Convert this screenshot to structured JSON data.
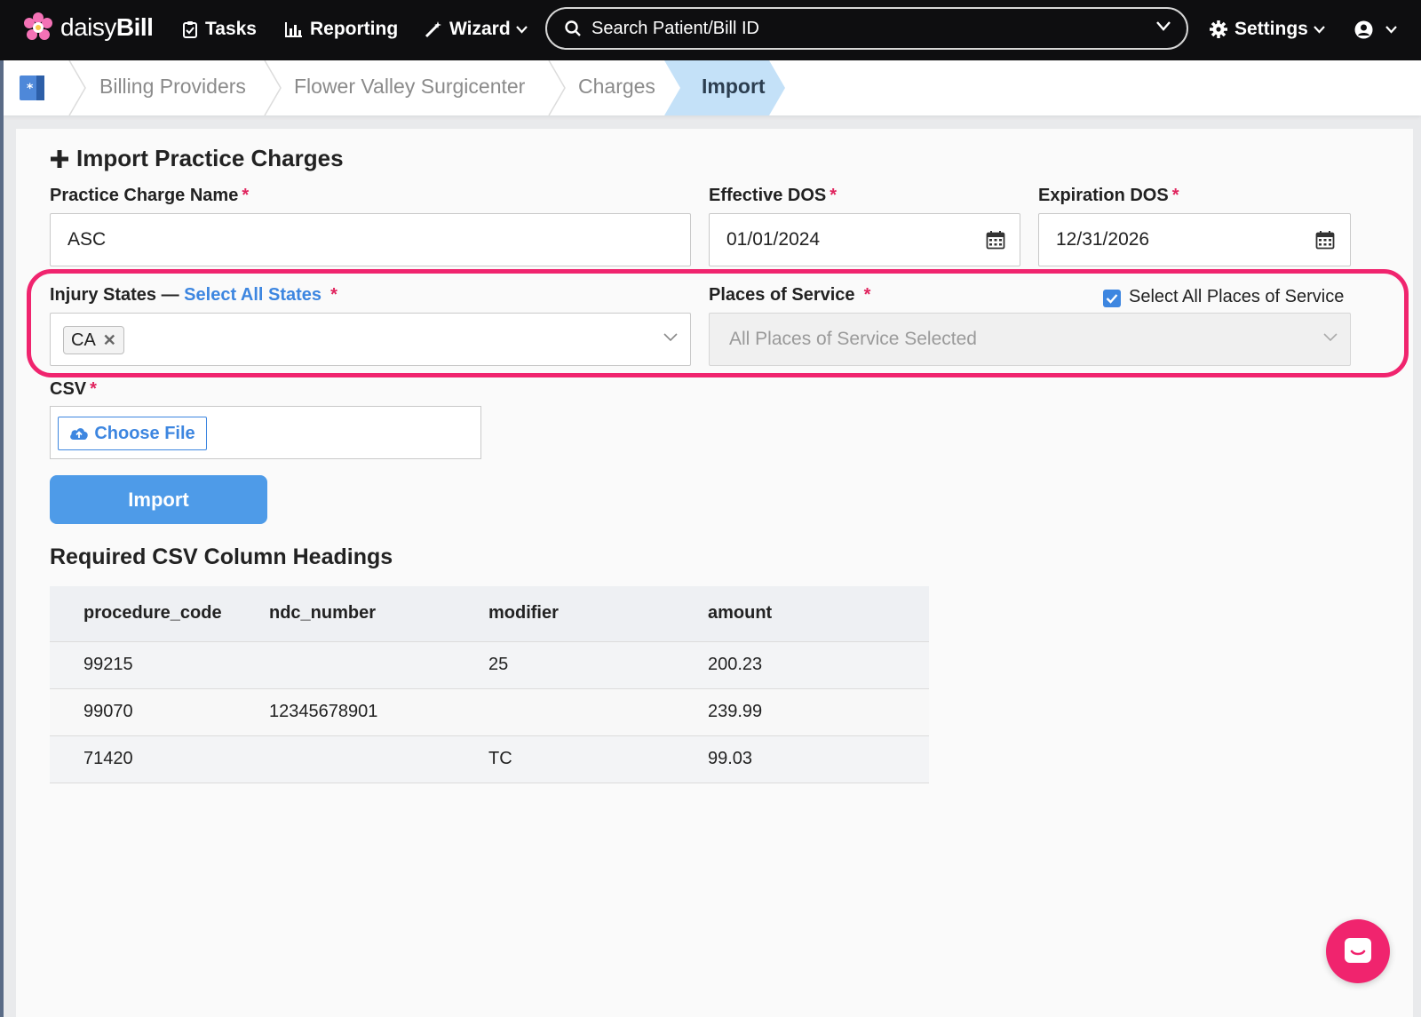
{
  "nav": {
    "brand_light": "daisy",
    "brand_bold": "Bill",
    "tasks": "Tasks",
    "reporting": "Reporting",
    "wizard": "Wizard",
    "search_placeholder": "Search Patient/Bill ID",
    "settings": "Settings"
  },
  "breadcrumb": {
    "items": [
      "Billing Providers",
      "Flower Valley Surgicenter",
      "Charges"
    ],
    "active": "Import"
  },
  "form": {
    "title": "Import Practice Charges",
    "charge_name_label": "Practice Charge Name",
    "charge_name_value": "ASC",
    "effective_label": "Effective DOS",
    "effective_value": "01/01/2024",
    "expiration_label": "Expiration DOS",
    "expiration_value": "12/31/2026",
    "injury_label": "Injury States —",
    "select_all_states": "Select All States",
    "selected_state": "CA",
    "pos_label": "Places of Service",
    "select_all_pos": "Select All Places of Service",
    "select_all_pos_checked": true,
    "pos_placeholder": "All Places of Service Selected",
    "csv_label": "CSV",
    "choose_file": "Choose File",
    "import_button": "Import",
    "required_mark": "*"
  },
  "csv_table": {
    "heading": "Required CSV Column Headings",
    "columns": [
      "procedure_code",
      "ndc_number",
      "modifier",
      "amount"
    ],
    "rows": [
      [
        "99215",
        "",
        "25",
        "200.23"
      ],
      [
        "99070",
        "12345678901",
        "",
        "239.99"
      ],
      [
        "71420",
        "",
        "TC",
        "99.03"
      ]
    ]
  },
  "colors": {
    "accent": "#3d86e0",
    "highlight": "#f0246e",
    "nav_bg": "#0e0e10",
    "breadcrumb_active": "#c4e1f8"
  },
  "icons": [
    "daisy-logo-icon",
    "clipboard-icon",
    "bar-chart-icon",
    "magic-wand-icon",
    "search-icon",
    "chevron-down-icon",
    "gear-icon",
    "user-circle-icon",
    "calendar-icon",
    "cloud-upload-icon",
    "chat-icon",
    "plus-icon",
    "home-icon"
  ]
}
